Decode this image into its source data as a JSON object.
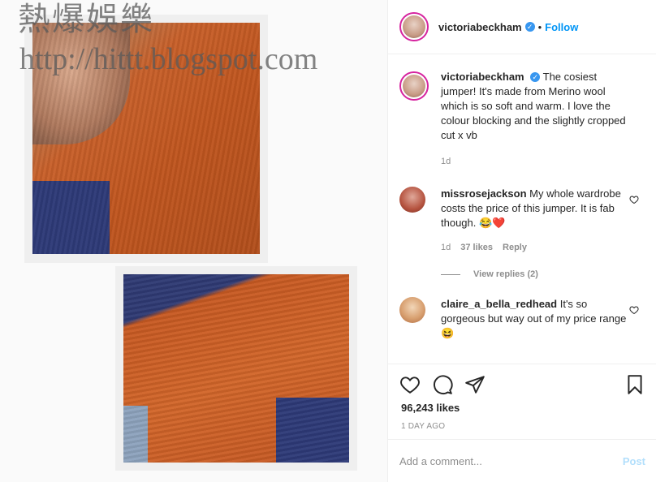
{
  "watermark": {
    "line1": "熱爆娛樂",
    "line2": "http://hittt.blogspot.com"
  },
  "header": {
    "username": "victoriabeckham",
    "dot": "•",
    "follow_label": "Follow"
  },
  "caption": {
    "username": "victoriabeckham",
    "text": "The cosiest jumper! It's made from Merino wool which is so soft and warm. I love the colour blocking and the slightly cropped cut x vb",
    "age": "1d"
  },
  "comments": [
    {
      "username": "missrosejackson",
      "text": "My whole wardrobe costs the price of this jumper. It is fab though. 😂❤️",
      "age": "1d",
      "likes": "37 likes",
      "reply_label": "Reply",
      "view_replies": "View replies (2)"
    },
    {
      "username": "claire_a_bella_redhead",
      "text": "It's so gorgeous but way out of my price range 😆"
    }
  ],
  "post": {
    "likes": "96,243 likes",
    "date": "1 DAY AGO"
  },
  "comment_box": {
    "placeholder": "Add a comment...",
    "post_label": "Post"
  },
  "colors": {
    "accent": "#0095f6",
    "post_disabled": "#b2dffc",
    "muted": "#8e8e8e"
  }
}
